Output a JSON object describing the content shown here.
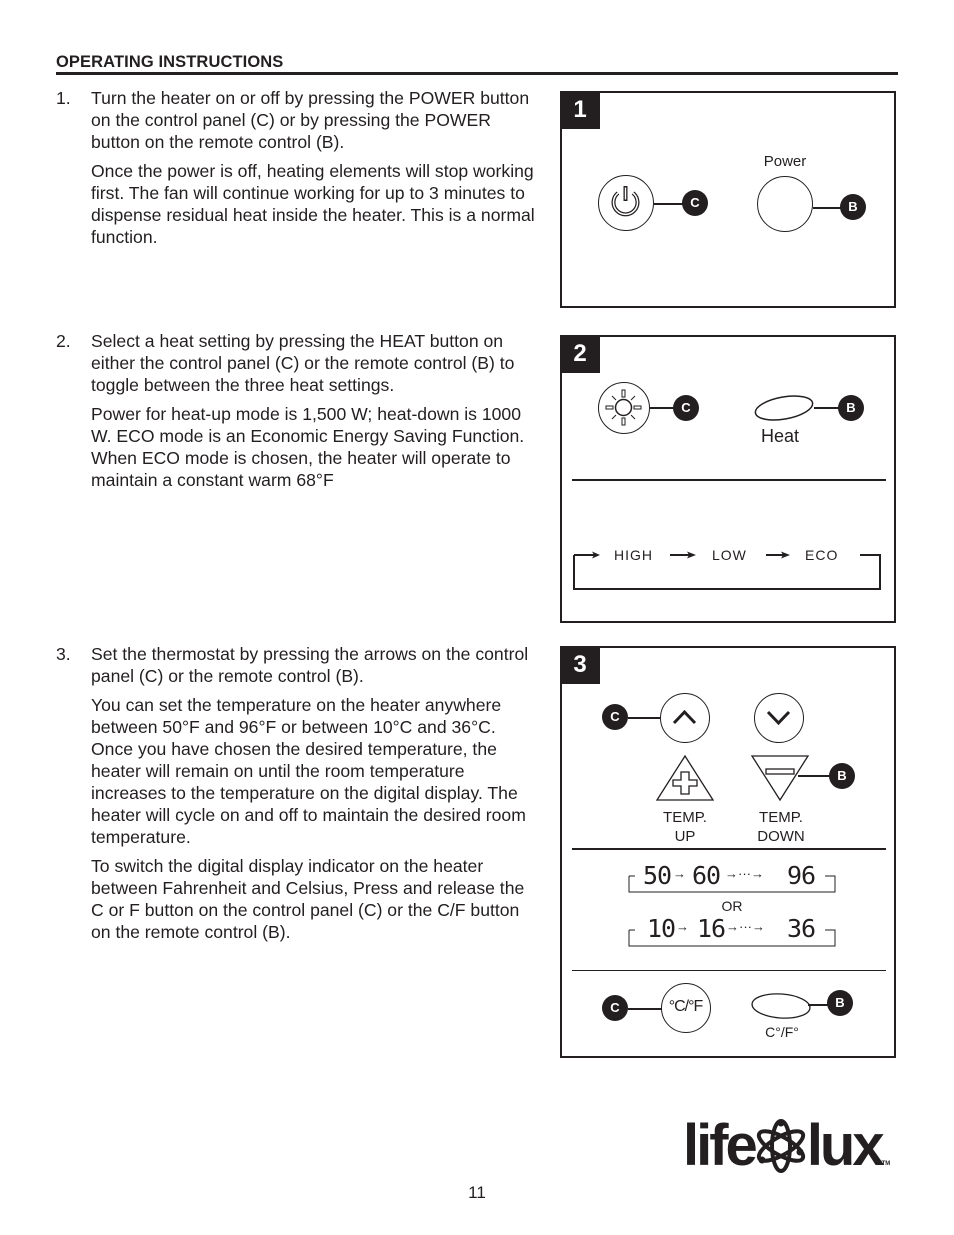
{
  "header": {
    "title": "OPERATING INSTRUCTIONS"
  },
  "steps": [
    {
      "number": "1.",
      "paragraphs": [
        "Turn the heater on or off by pressing the POWER button on the control panel (C) or by pressing the POWER button on the remote control (B).",
        "Once the power is off, heating elements will stop working first. The fan will continue working for up to 3 minutes to dispense residual heat inside the heater. This is a normal function."
      ]
    },
    {
      "number": "2.",
      "paragraphs": [
        "Select a heat setting by pressing the HEAT button on either the control panel (C) or the remote control (B) to toggle between the three heat settings.",
        "Power for heat-up mode is 1,500 W; heat-down is 1000 W. ECO mode is an Economic Energy Saving Function. When ECO mode is chosen, the heater will operate to maintain a constant warm 68°F"
      ]
    },
    {
      "number": "3.",
      "paragraphs": [
        "Set the thermostat by pressing the arrows on the control panel (C) or the remote control (B).",
        "You can set the temperature on the heater anywhere between 50°F and 96°F or between 10°C and 36°C. Once you have chosen the desired temperature, the heater will remain on until the room temperature increases to the temperature on the digital display. The heater will cycle on and off to maintain the desired room temperature.",
        "To switch the digital display indicator on the heater between Fahrenheit and Celsius, Press and release the C or F button on the control panel (C) or the C/F button on the remote control (B)."
      ]
    }
  ],
  "figures": {
    "fig1": {
      "badge": "1",
      "callout_c": "C",
      "callout_b": "B",
      "remote_label": "Power"
    },
    "fig2": {
      "badge": "2",
      "callout_c": "C",
      "callout_b": "B",
      "remote_label": "Heat",
      "cycle": [
        "HIGH",
        "LOW",
        "ECO"
      ]
    },
    "fig3": {
      "badge": "3",
      "callout_c": "C",
      "callout_b": "B",
      "temp_up": [
        "TEMP.",
        "UP"
      ],
      "temp_down": [
        "TEMP.",
        "DOWN"
      ],
      "f_sequence": {
        "a": "50",
        "b": "60",
        "end": "96"
      },
      "or_label": "OR",
      "c_sequence": {
        "a": "10",
        "b": "16",
        "end": "36"
      },
      "cf_button": "°C/°F",
      "cf_remote_label": "C°/F°",
      "callout_c2": "C",
      "callout_b2": "B"
    }
  },
  "footer": {
    "page_number": "11",
    "brand_left": "life",
    "brand_right": "lux",
    "trademark": "TM"
  }
}
